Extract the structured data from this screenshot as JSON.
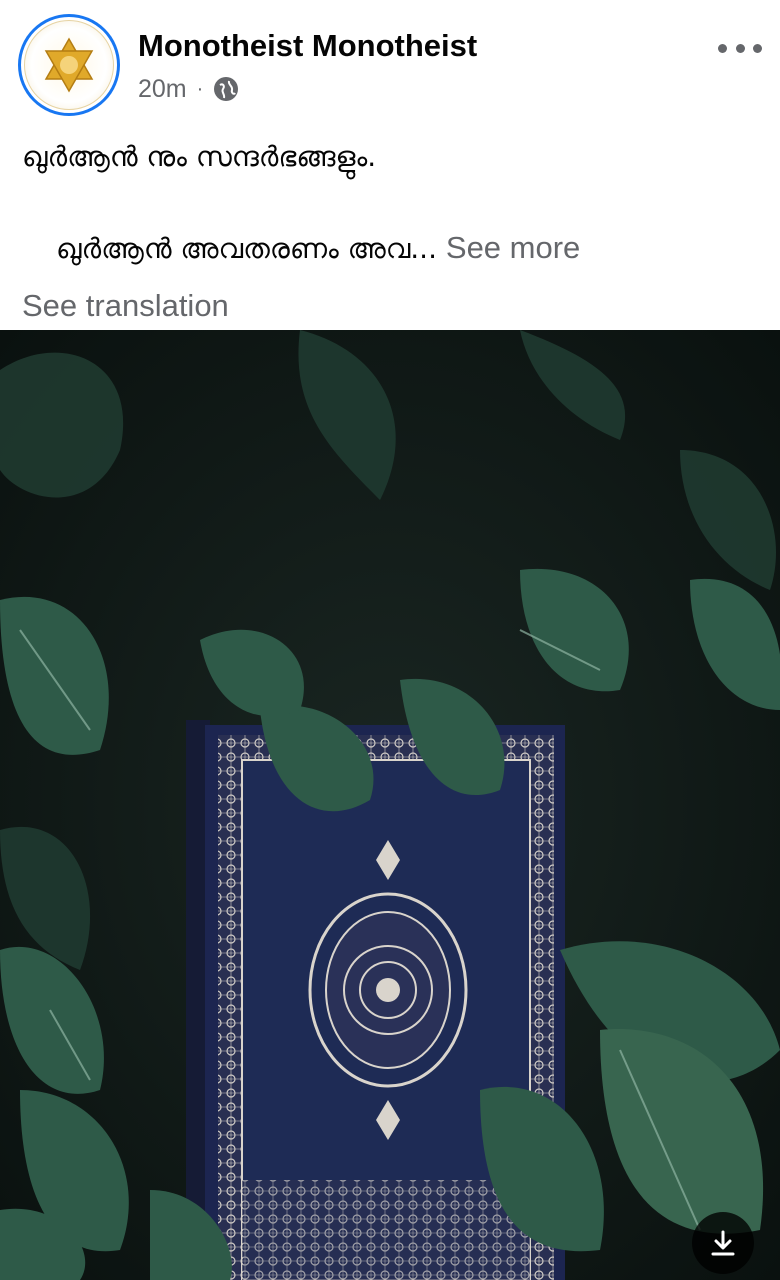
{
  "post": {
    "author": "Monotheist Monotheist",
    "time": "20m",
    "separator": "·",
    "audience_icon": "globe-icon",
    "text_line1": "ഖുർആൻ നും സന്ദർഭങ്ങളും.",
    "text_line2": "ഖുർആൻ അവതരണം അവ...",
    "see_more": "See more",
    "see_translation": "See translation"
  },
  "icons": {
    "more": "more-options-icon",
    "download": "download-icon",
    "avatar": "star-of-david-logo"
  },
  "colors": {
    "accent": "#1877f2",
    "secondary_text": "#65676b",
    "leaf": "#2e5a48",
    "book_cover": "#1e2b55",
    "ornament": "#d9d4cc"
  }
}
